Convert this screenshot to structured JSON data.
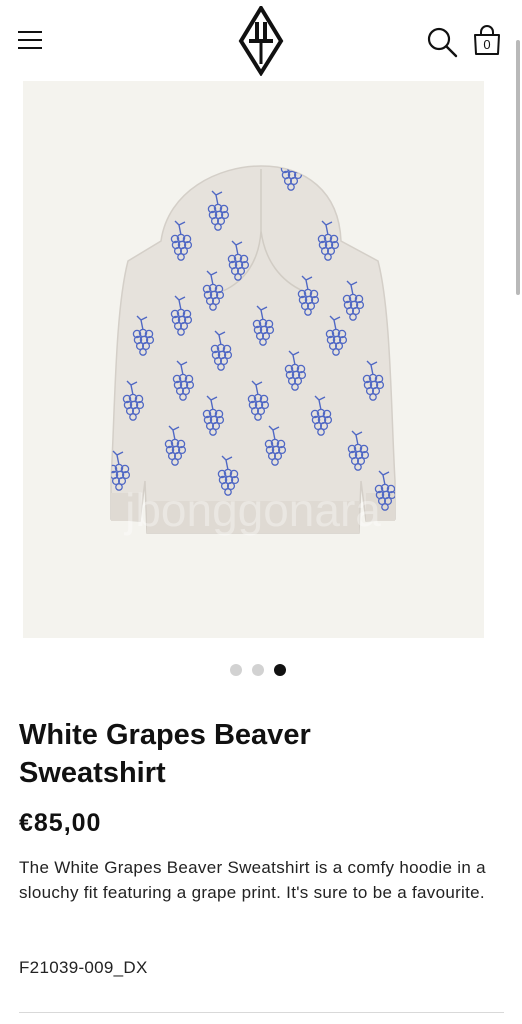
{
  "header": {
    "menu_icon": "hamburger-menu-icon",
    "logo_icon": "diamond-logo-icon",
    "search_icon": "search-icon",
    "bag_icon": "shopping-bag-icon",
    "bag_count": "0"
  },
  "gallery": {
    "image": "hoodie-back-grape-print",
    "watermark": "jbonggonara",
    "slide_count": 3,
    "active_slide": 3
  },
  "product": {
    "title": "White Grapes Beaver Sweatshirt",
    "price": "€85,00",
    "description": "The White Grapes Beaver Sweatshirt is a comfy hoodie in a slouchy fit featuring a grape print. It's sure to be a favourite.",
    "sku": "F21039-009_DX"
  },
  "colors": {
    "text": "#111111",
    "image_background": "#f4f3ee",
    "garment": "#e6e2dc",
    "grape_print": "#5068c4",
    "dot_inactive": "#d2d2d2",
    "dot_active": "#111111"
  }
}
